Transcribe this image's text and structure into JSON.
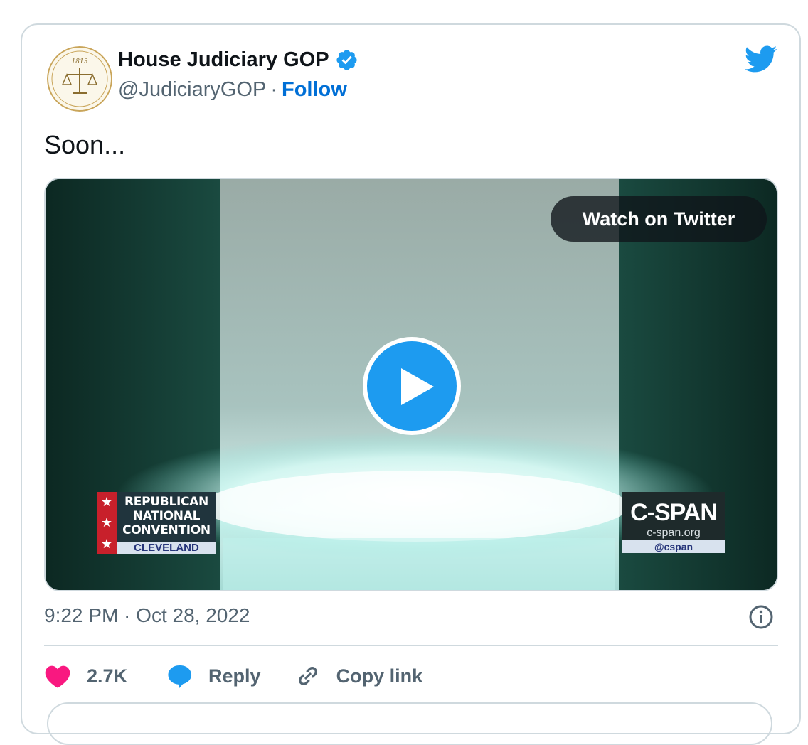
{
  "account": {
    "name": "House Judiciary GOP",
    "handle": "@JudiciaryGOP",
    "separator": "·",
    "follow_label": "Follow",
    "avatar_year": "1813"
  },
  "tweet": {
    "text": "Soon...",
    "timestamp": "9:22 PM · Oct 28, 2022"
  },
  "media": {
    "watch_label": "Watch on Twitter",
    "rnc_lines": [
      "REPUBLICAN",
      "NATIONAL",
      "CONVENTION"
    ],
    "rnc_city": "CLEVELAND",
    "cspan_logo": "C-SPAN",
    "cspan_url": "c-span.org",
    "cspan_handle": "@cspan"
  },
  "actions": {
    "likes": "2.7K",
    "reply_label": "Reply",
    "copy_label": "Copy link"
  },
  "colors": {
    "accent": "#1d9bf0",
    "like": "#f91880",
    "muted": "#536471"
  }
}
